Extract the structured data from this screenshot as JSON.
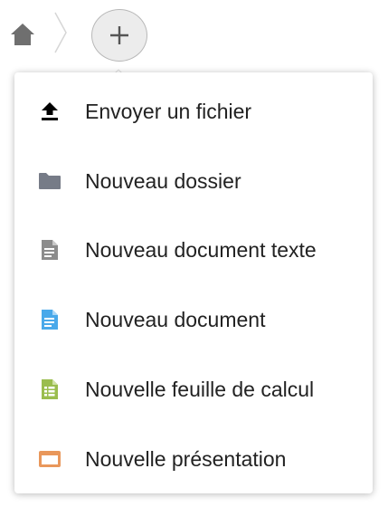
{
  "colors": {
    "home": "#6f6f6f",
    "folder": "#767b87",
    "text_doc": "#8c8c8c",
    "document": "#49a9ea",
    "spreadsheet": "#9abd4e",
    "presentation": "#e9975b"
  },
  "breadcrumb": {
    "home_icon": "home-icon",
    "add_icon": "plus-icon"
  },
  "menu": {
    "items": [
      {
        "label": "Envoyer un fichier",
        "icon": "upload-icon"
      },
      {
        "label": "Nouveau dossier",
        "icon": "folder-icon"
      },
      {
        "label": "Nouveau document texte",
        "icon": "text-file-icon"
      },
      {
        "label": "Nouveau document",
        "icon": "document-icon"
      },
      {
        "label": "Nouvelle feuille de calcul",
        "icon": "spreadsheet-icon"
      },
      {
        "label": "Nouvelle présentation",
        "icon": "presentation-icon"
      }
    ]
  }
}
